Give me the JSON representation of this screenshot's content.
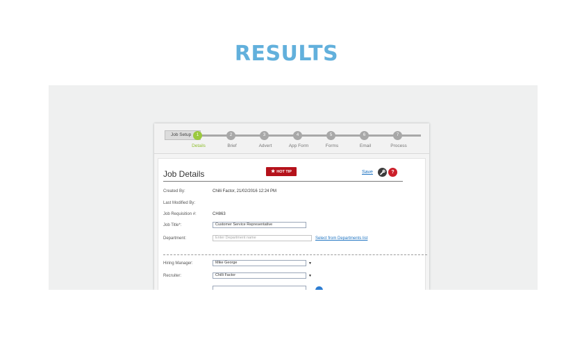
{
  "page": {
    "heading": "RESULTS"
  },
  "stepper": {
    "job_setup_label": "Job Setup",
    "steps": [
      {
        "number": "1",
        "label": "Details",
        "active": true
      },
      {
        "number": "2",
        "label": "Brief",
        "active": false
      },
      {
        "number": "3",
        "label": "Advert",
        "active": false
      },
      {
        "number": "4",
        "label": "App Form",
        "active": false
      },
      {
        "number": "5",
        "label": "Forms",
        "active": false
      },
      {
        "number": "6",
        "label": "Email",
        "active": false
      },
      {
        "number": "7",
        "label": "Process",
        "active": false
      }
    ]
  },
  "card": {
    "title": "Job Details",
    "hot_tip_label": "HOT TIP",
    "save_label": "Save",
    "tools_icon": "wrench-icon",
    "help_icon": "question-icon",
    "help_glyph": "?"
  },
  "fields": {
    "created_by": {
      "label": "Created By:",
      "value": "Chilli Factor, 21/02/2016  12:24 PM"
    },
    "last_modified_by": {
      "label": "Last Modified By:"
    },
    "job_requisition": {
      "label": "Job Requisition #:",
      "value": "CH863"
    },
    "job_title": {
      "label": "Job Title*:",
      "value": "Customer Service Representative"
    },
    "department": {
      "label": "Department:",
      "placeholder": "Enter Department name",
      "link": "Select from Departments list"
    },
    "hiring_manager": {
      "label": "Hiring Manager:",
      "value": "Mike George"
    },
    "recruiter": {
      "label": "Recruiter:",
      "value": "Chilli Factor"
    }
  },
  "colors": {
    "heading": "#62b0dc",
    "active_step": "#9bc93e",
    "hot_tip": "#b5121b",
    "link": "#1f74c2",
    "help_icon": "#cc1f2a"
  }
}
